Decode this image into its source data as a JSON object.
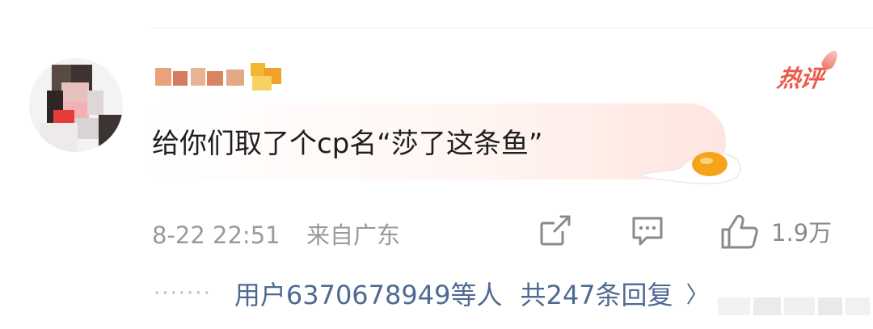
{
  "comment": {
    "text": "给你们取了个cp名“莎了这条鱼”",
    "timestamp": "8-22 22:51",
    "location": "来自广东",
    "badge": "热评",
    "likes": "1.9万"
  },
  "replies": {
    "users_text": "用户6370678949等人",
    "count_text": "共247条回复",
    "chevron": "〉"
  },
  "icons": {
    "share": "share-icon",
    "comment": "comment-icon",
    "like": "thumbs-up-icon",
    "more": "more-dots-icon",
    "decoration": "fried-egg-icon"
  },
  "colors": {
    "badge": "#ec5a4b",
    "link": "#4f6a92",
    "meta": "#9a9a9a",
    "text": "#1f1f1f"
  }
}
